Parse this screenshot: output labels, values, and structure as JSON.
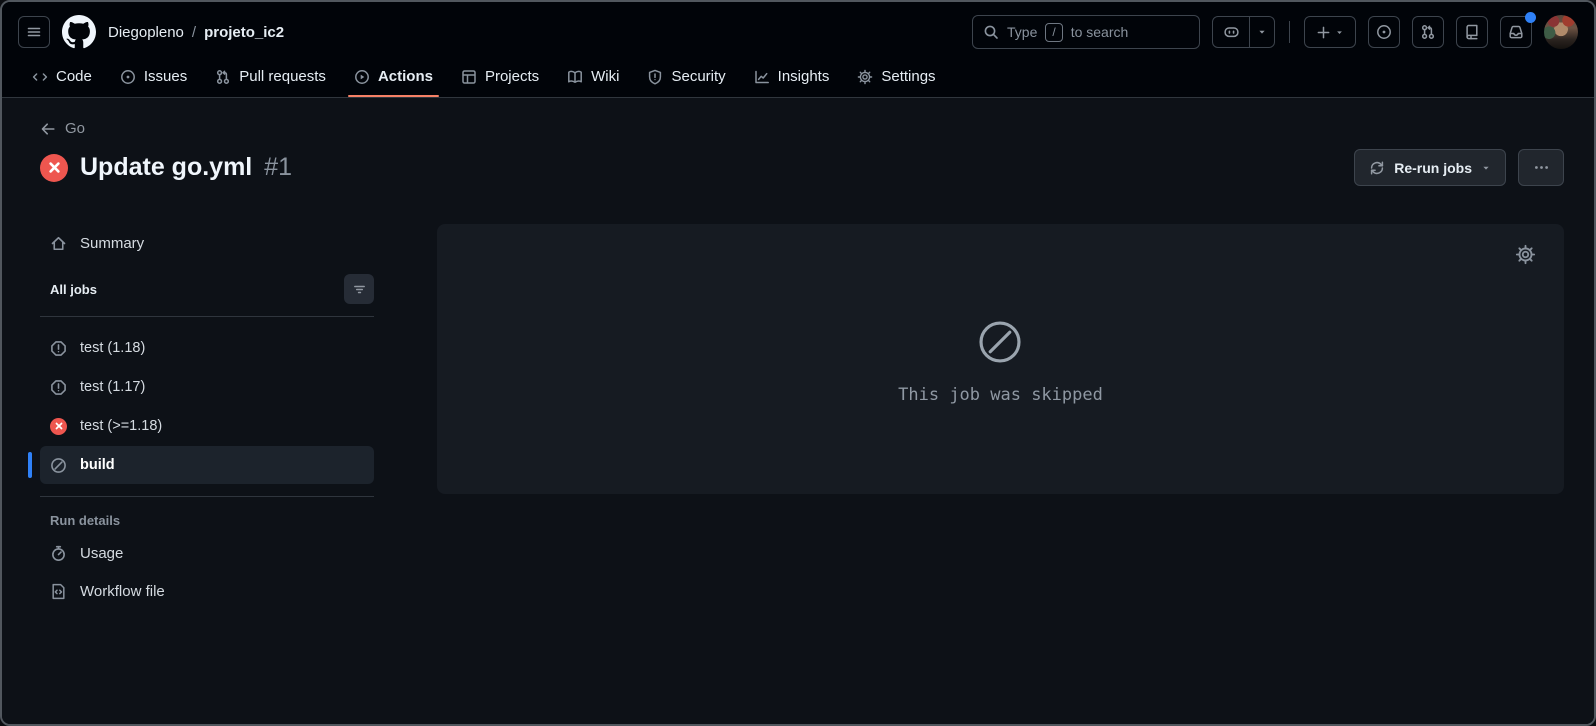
{
  "header": {
    "breadcrumb": {
      "owner": "Diegopleno",
      "separator": "/",
      "repo": "projeto_ic2"
    },
    "search": {
      "prefix": "Type",
      "key": "/",
      "suffix": "to search"
    }
  },
  "nav": {
    "tabs": [
      {
        "label": "Code",
        "icon": "code-icon",
        "active": false
      },
      {
        "label": "Issues",
        "icon": "issue-opened-icon",
        "active": false
      },
      {
        "label": "Pull requests",
        "icon": "git-pull-request-icon",
        "active": false
      },
      {
        "label": "Actions",
        "icon": "play-icon",
        "active": true
      },
      {
        "label": "Projects",
        "icon": "table-icon",
        "active": false
      },
      {
        "label": "Wiki",
        "icon": "book-icon",
        "active": false
      },
      {
        "label": "Security",
        "icon": "shield-icon",
        "active": false
      },
      {
        "label": "Insights",
        "icon": "graph-icon",
        "active": false
      },
      {
        "label": "Settings",
        "icon": "gear-icon",
        "active": false
      }
    ]
  },
  "run": {
    "back_label": "Go",
    "title": "Update go.yml",
    "number": "#1",
    "status": "failure",
    "rerun_label": "Re-run jobs"
  },
  "sidebar": {
    "summary_label": "Summary",
    "all_jobs_label": "All jobs",
    "jobs": [
      {
        "label": "test (1.18)",
        "status": "stale",
        "selected": false
      },
      {
        "label": "test (1.17)",
        "status": "stale",
        "selected": false
      },
      {
        "label": "test (>=1.18)",
        "status": "failed",
        "selected": false
      },
      {
        "label": "build",
        "status": "skipped",
        "selected": true
      }
    ],
    "run_details_label": "Run details",
    "usage_label": "Usage",
    "workflow_file_label": "Workflow file"
  },
  "main": {
    "skipped_message": "This job was skipped"
  },
  "colors": {
    "accent_blue": "#2f81f7",
    "failure_red": "#ee564f",
    "active_tab_underline": "#f78166",
    "panel_background": "#161b22",
    "header_background": "#010409",
    "page_background": "#0d1117"
  }
}
